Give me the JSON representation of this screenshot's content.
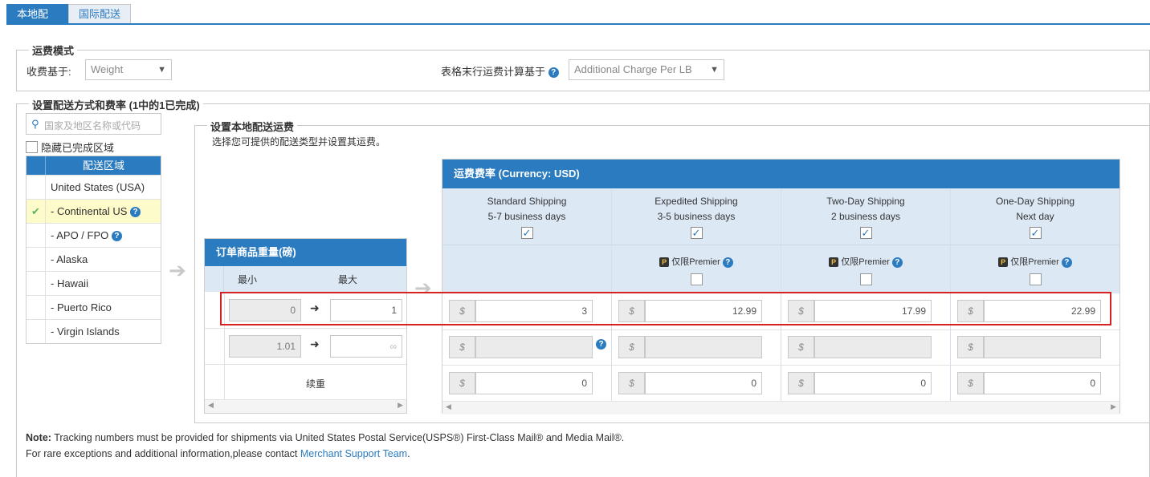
{
  "tabs": [
    {
      "label": "本地配送",
      "active": true
    },
    {
      "label": "国际配送",
      "active": false
    }
  ],
  "fee_mode": {
    "legend": "运费模式",
    "charge_basis_label": "收费基于:",
    "charge_basis_value": "Weight",
    "last_row_label": "表格末行运费计算基于",
    "last_row_value": "Additional Charge Per LB"
  },
  "shipping_setup": {
    "legend": "设置配送方式和费率 (1中的1已完成)",
    "search_placeholder": "国家及地区名称或代码",
    "hide_completed_label": "隐藏已完成区域",
    "region_header": "配送区域",
    "regions": [
      {
        "label": "United States (USA)",
        "status": "",
        "help": false
      },
      {
        "label": "-  Continental US",
        "status": "✔",
        "help": true,
        "selected": true
      },
      {
        "label": "-  APO / FPO",
        "status": "",
        "help": true
      },
      {
        "label": "-  Alaska",
        "status": "",
        "help": false
      },
      {
        "label": "-  Hawaii",
        "status": "",
        "help": false
      },
      {
        "label": "-  Puerto Rico",
        "status": "",
        "help": false
      },
      {
        "label": "-  Virgin Islands",
        "status": "",
        "help": false
      }
    ]
  },
  "local_rates": {
    "legend": "设置本地配送运费",
    "instruction": "选择您可提供的配送类型并设置其运费。",
    "weight_table": {
      "header": "订单商品重量(磅)",
      "min_label": "最小",
      "max_label": "最大",
      "rows": [
        {
          "min": "0",
          "max": "1"
        },
        {
          "min": "1.01",
          "max": "∞"
        }
      ],
      "renewal_label": "续重"
    },
    "rate_table": {
      "header": "运费费率 (Currency: USD)",
      "premier_label": "仅限Premier",
      "currency_symbol": "$",
      "columns": [
        {
          "name": "Standard Shipping",
          "days": "5-7 business days",
          "checked": true,
          "rates": [
            "3",
            "",
            "0"
          ]
        },
        {
          "name": "Expedited Shipping",
          "days": "3-5 business days",
          "checked": true,
          "rates": [
            "12.99",
            "",
            "0"
          ]
        },
        {
          "name": "Two-Day Shipping",
          "days": "2 business days",
          "checked": true,
          "rates": [
            "17.99",
            "",
            "0"
          ]
        },
        {
          "name": "One-Day Shipping",
          "days": "Next day",
          "checked": true,
          "rates": [
            "22.99",
            "",
            "0"
          ]
        }
      ]
    }
  },
  "note": {
    "bold": "Note:",
    "line1": "Tracking numbers must be provided for shipments via United States Postal Service(USPS®) First-Class Mail® and Media Mail®.",
    "line2": "For rare exceptions and additional information,please contact",
    "link": "Merchant Support Team",
    "line2_end": "."
  }
}
